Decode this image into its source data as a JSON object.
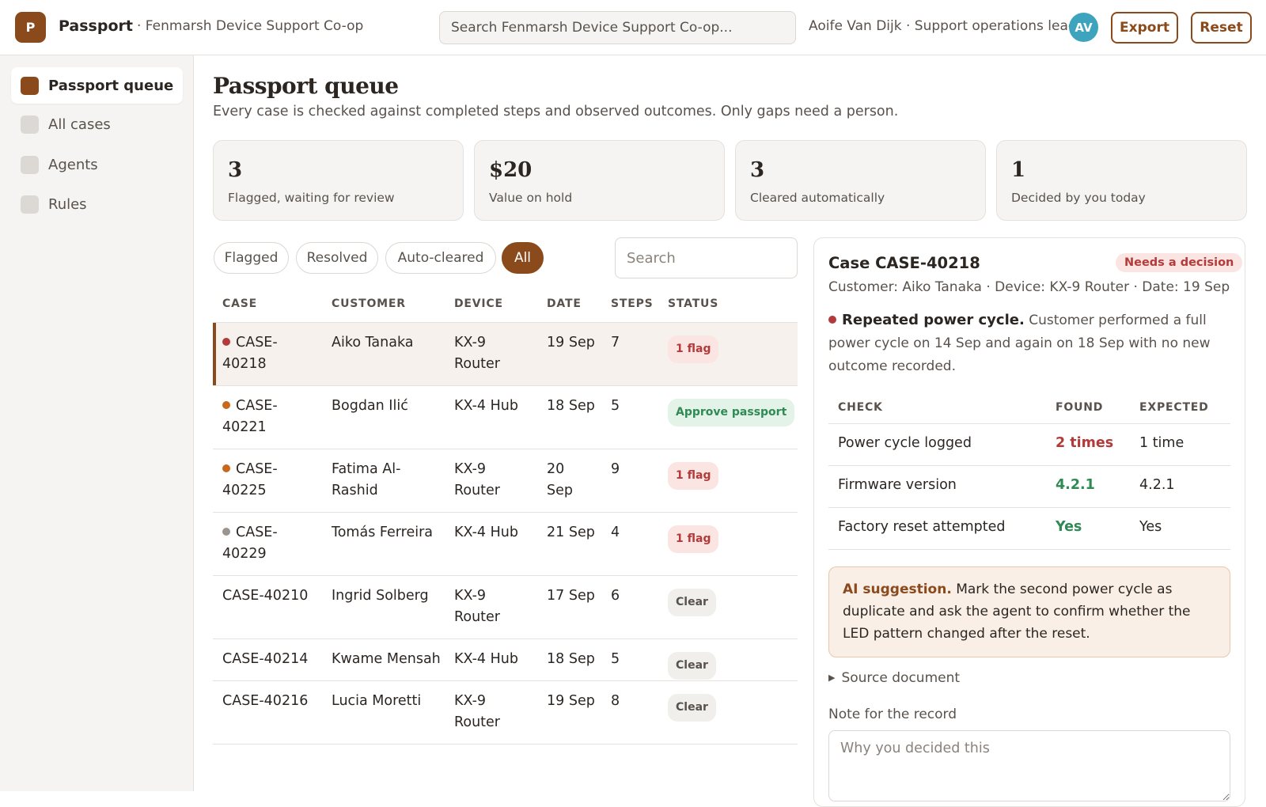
{
  "header": {
    "logo_letter": "P",
    "app_title": "Passport",
    "org": "· Fenmarsh Device Support Co-op",
    "search_placeholder": "Search Fenmarsh Device Support Co-op...",
    "user": "Aoife Van Dijk · Support operations lead",
    "avatar_initials": "AV",
    "export_label": "Export",
    "reset_label": "Reset"
  },
  "sidebar": {
    "items": [
      {
        "label": "Passport queue",
        "active": true
      },
      {
        "label": "All cases",
        "active": false
      },
      {
        "label": "Agents",
        "active": false
      },
      {
        "label": "Rules",
        "active": false
      }
    ]
  },
  "main": {
    "title": "Passport queue",
    "subtitle": "Every case is checked against completed steps and observed outcomes. Only gaps need a person.",
    "stats": [
      {
        "value": "3",
        "label": "Flagged, waiting for review"
      },
      {
        "value": "$20",
        "label": "Value on hold"
      },
      {
        "value": "3",
        "label": "Cleared automatically"
      },
      {
        "value": "1",
        "label": "Decided by you today"
      }
    ],
    "filters": [
      "Flagged",
      "Resolved",
      "Auto-cleared",
      "All"
    ],
    "active_filter": "All",
    "search_placeholder": "Search"
  },
  "table": {
    "columns": [
      "CASE",
      "CUSTOMER",
      "DEVICE",
      "DATE",
      "STEPS",
      "STATUS"
    ],
    "rows": [
      {
        "dot": "#b33a3a",
        "case": "CASE-\n40218",
        "customer": "Aiko Tanaka",
        "device": "KX-9\nRouter",
        "date": "19 Sep",
        "steps": "7",
        "status": "1 flag",
        "status_type": "flag",
        "selected": true
      },
      {
        "dot": "#c8681e",
        "case": "CASE-\n40221",
        "customer": "Bogdan Ilić",
        "device": "KX-4 Hub",
        "date": "18 Sep",
        "steps": "5",
        "status": "Approve passport",
        "status_type": "approve"
      },
      {
        "dot": "#c8681e",
        "case": "CASE-\n40225",
        "customer": "Fatima Al-\nRashid",
        "device": "KX-9\nRouter",
        "date": "20\nSep",
        "steps": "9",
        "status": "1 flag",
        "status_type": "flag"
      },
      {
        "dot": "#9b9590",
        "case": "CASE-\n40229",
        "customer": "Tomás Ferreira",
        "device": "KX-4 Hub",
        "date": "21 Sep",
        "steps": "4",
        "status": "1 flag",
        "status_type": "flag"
      },
      {
        "dot": null,
        "case": "CASE-40210",
        "customer": "Ingrid Solberg",
        "device": "KX-9\nRouter",
        "date": "17 Sep",
        "steps": "6",
        "status": "Clear",
        "status_type": "clear"
      },
      {
        "dot": null,
        "case": "CASE-40214",
        "customer": "Kwame Mensah",
        "device": "KX-4 Hub",
        "date": "18 Sep",
        "steps": "5",
        "status": "Clear",
        "status_type": "clear"
      },
      {
        "dot": null,
        "case": "CASE-40216",
        "customer": "Lucia Moretti",
        "device": "KX-9\nRouter",
        "date": "19 Sep",
        "steps": "8",
        "status": "Clear",
        "status_type": "clear"
      }
    ]
  },
  "detail": {
    "title": "Case CASE-40218",
    "badge": "Needs a decision",
    "meta": "Customer: Aiko Tanaka · Device: KX-9 Router · Date: 19 Sep",
    "flag_title": "Repeated power cycle.",
    "flag_text": " Customer performed a full power cycle on 14 Sep and again on 18 Sep with no new outcome recorded.",
    "check_columns": [
      "CHECK",
      "FOUND",
      "EXPECTED"
    ],
    "checks": [
      {
        "check": "Power cycle logged",
        "found": "2 times",
        "expected": "1 time",
        "match": false
      },
      {
        "check": "Firmware version",
        "found": "4.2.1",
        "expected": "4.2.1",
        "match": true
      },
      {
        "check": "Factory reset attempted",
        "found": "Yes",
        "expected": "Yes",
        "match": true
      }
    ],
    "ai_title": "AI suggestion.",
    "ai_text": " Mark the second power cycle as duplicate and ask the agent to confirm whether the LED pattern changed after the reset.",
    "source_label": "Source document",
    "note_label": "Note for the record",
    "note_placeholder": "Why you decided this"
  }
}
